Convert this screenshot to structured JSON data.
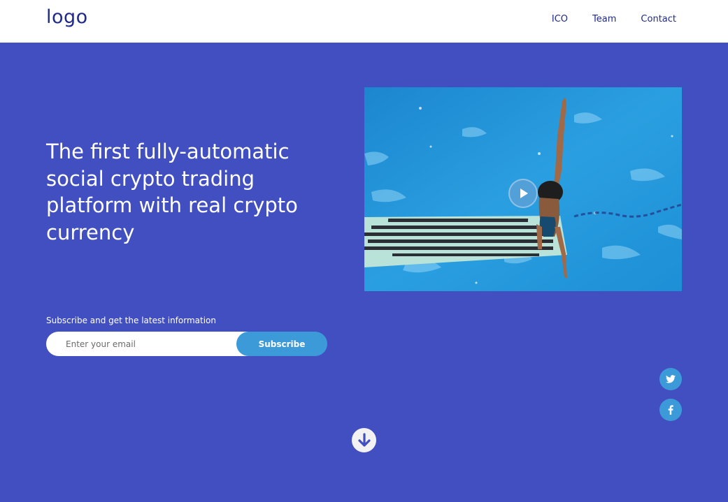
{
  "header": {
    "logo": "logo",
    "nav": [
      {
        "label": "ICO"
      },
      {
        "label": "Team"
      },
      {
        "label": "Contact"
      }
    ]
  },
  "hero": {
    "headline": "The first fully-automatic social crypto trading platform with real crypto currency"
  },
  "subscribe": {
    "label": "Subscribe and get the latest information",
    "email_placeholder": "Enter your email",
    "button_label": "Subscribe"
  },
  "video": {
    "play_icon": "play-icon"
  },
  "social": {
    "twitter_icon": "twitter-icon",
    "facebook_icon": "facebook-icon"
  },
  "scroll": {
    "icon": "arrow-down-icon"
  },
  "colors": {
    "hero_background": "#424fc0",
    "header_background": "#ffffff",
    "accent": "#3d9ad8",
    "nav_text": "#1f2a8a"
  }
}
